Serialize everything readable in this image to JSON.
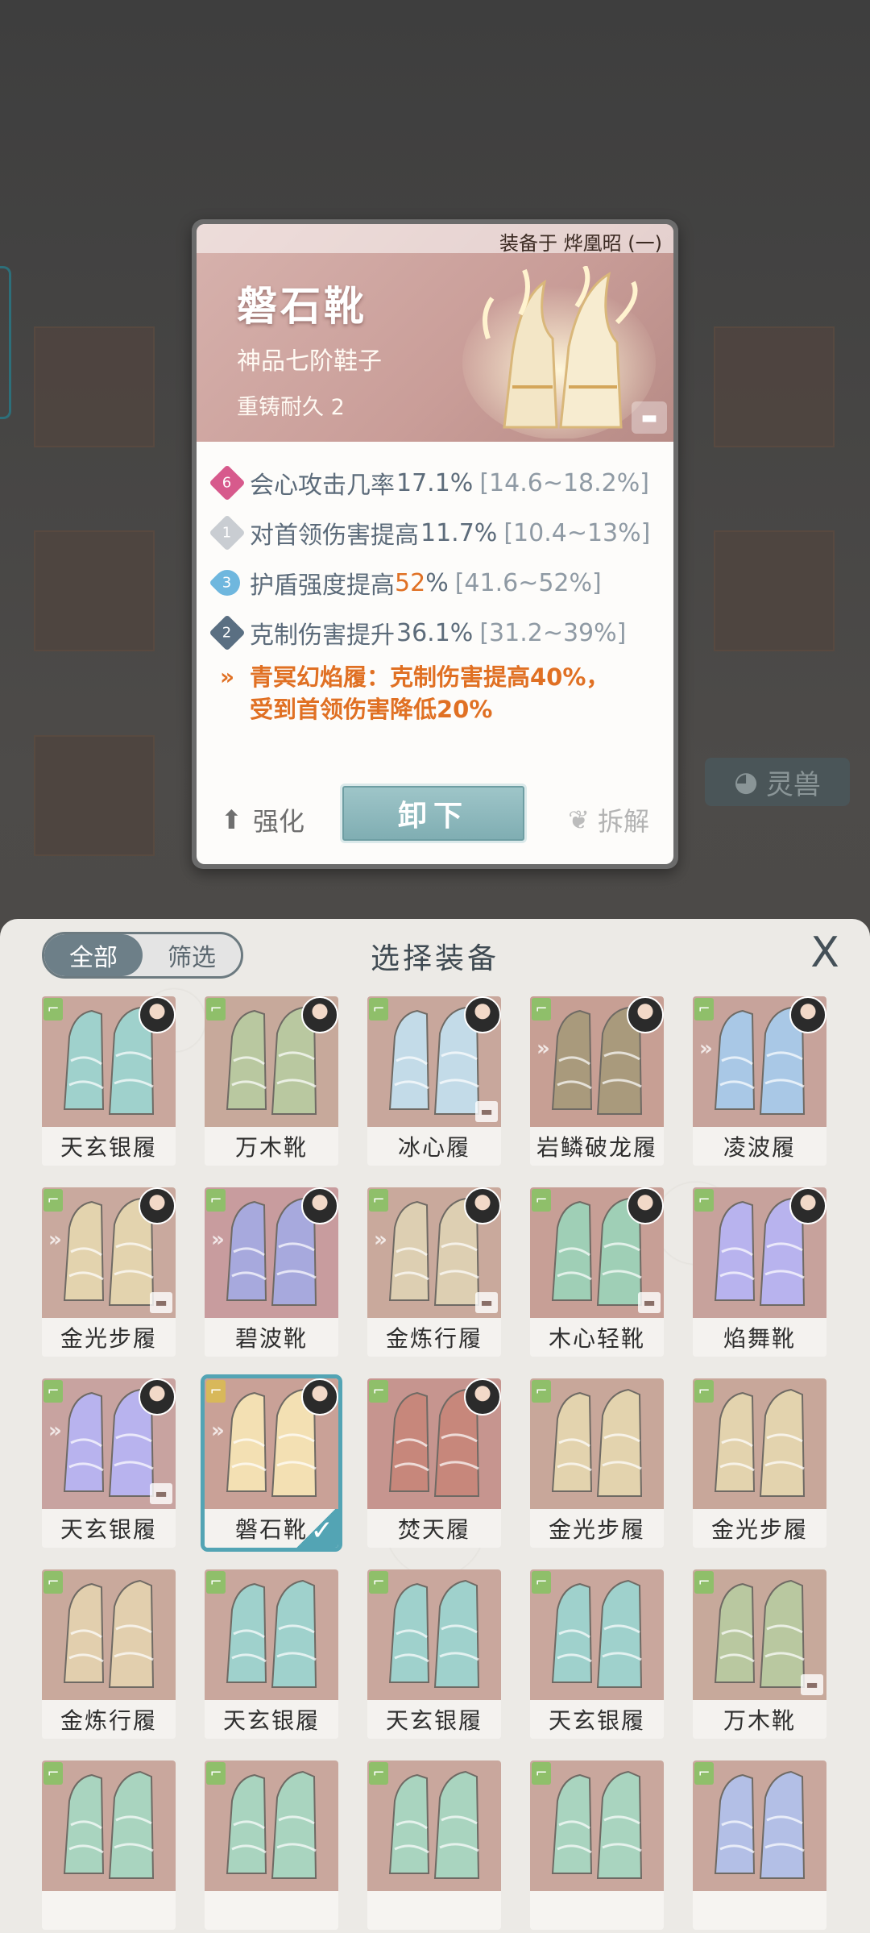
{
  "detail": {
    "equipped_on": "装备于 烨凰昭 (一)",
    "name": "磐石靴",
    "grade": "神品七阶鞋子",
    "durability": "重铸耐久 2",
    "stats": [
      {
        "badge": "6",
        "badge_color": "#d75a8c",
        "name": "会心攻击几率",
        "value": " 17.1%",
        "range": "[14.6~18.2%]"
      },
      {
        "badge": "1",
        "badge_color": "#c9cdd2",
        "name": "对首领伤害提高",
        "value": " 11.7%",
        "range": "[10.4~13%]"
      },
      {
        "badge": "3",
        "badge_color": "#6fb7de",
        "name": "护盾强度提高 ",
        "value_hl": "52",
        "value": "%",
        "range": "[41.6~52%]"
      },
      {
        "badge": "2",
        "badge_color": "#5a6f82",
        "name": "克制伤害提升",
        "value": "36.1%",
        "range": "[31.2~39%]"
      }
    ],
    "set_bonus_line1": "青冥幻焰履：克制伤害提高40%，",
    "set_bonus_line2": "受到首领伤害降低20%",
    "enhance_label": "强化",
    "unequip_label": "卸下",
    "dismantle_label": "拆解"
  },
  "background": {
    "pet_label": "灵兽"
  },
  "panel": {
    "filter_all": "全部",
    "filter_select": "筛选",
    "title": "选择装备",
    "close_glyph": "X"
  },
  "items": [
    {
      "name": "天玄银履",
      "bg": "#c9a79d",
      "boot": "#9fd1cc",
      "avatar": true,
      "set": false,
      "rebuild": false,
      "selected": false
    },
    {
      "name": "万木靴",
      "bg": "#c7a99b",
      "boot": "#b9c8a0",
      "avatar": true,
      "set": false,
      "rebuild": false,
      "selected": false
    },
    {
      "name": "冰心履",
      "bg": "#c8a79c",
      "boot": "#c3dbe8",
      "avatar": true,
      "set": false,
      "rebuild": true,
      "selected": false
    },
    {
      "name": "岩鳞破龙履",
      "bg": "#c79f94",
      "boot": "#a99a7c",
      "avatar": true,
      "set": true,
      "rebuild": false,
      "selected": false
    },
    {
      "name": "凌波履",
      "bg": "#c7a39b",
      "boot": "#a9c8e6",
      "avatar": true,
      "set": true,
      "rebuild": false,
      "selected": false
    },
    {
      "name": "金光步履",
      "bg": "#c9a99e",
      "boot": "#e3d3ae",
      "avatar": true,
      "set": true,
      "rebuild": true,
      "selected": false
    },
    {
      "name": "碧波靴",
      "bg": "#c89c9e",
      "boot": "#a7a9dd",
      "avatar": true,
      "set": true,
      "rebuild": false,
      "selected": false
    },
    {
      "name": "金炼行履",
      "bg": "#c9a99c",
      "boot": "#ddcfb2",
      "avatar": true,
      "set": true,
      "rebuild": true,
      "selected": false
    },
    {
      "name": "木心轻靴",
      "bg": "#c79f96",
      "boot": "#9fcfb6",
      "avatar": true,
      "set": false,
      "rebuild": true,
      "selected": false
    },
    {
      "name": "焰舞靴",
      "bg": "#c7a29c",
      "boot": "#b8b3ee",
      "avatar": true,
      "set": false,
      "rebuild": false,
      "selected": false
    },
    {
      "name": "天玄银履",
      "bg": "#c8a3a0",
      "boot": "#b8b3ee",
      "avatar": true,
      "set": true,
      "rebuild": true,
      "selected": false
    },
    {
      "name": "磐石靴",
      "bg": "#c9a197",
      "boot": "#f3e0b3",
      "avatar": true,
      "set": true,
      "rebuild": false,
      "selected": true
    },
    {
      "name": "焚天履",
      "bg": "#c6958f",
      "boot": "#c7877b",
      "avatar": true,
      "set": false,
      "rebuild": false,
      "selected": false
    },
    {
      "name": "金光步履",
      "bg": "#c8a79a",
      "boot": "#e3d3ae",
      "avatar": false,
      "set": false,
      "rebuild": false,
      "selected": false
    },
    {
      "name": "金光步履",
      "bg": "#c8a79a",
      "boot": "#e3d3ae",
      "avatar": false,
      "set": false,
      "rebuild": false,
      "selected": false
    },
    {
      "name": "金炼行履",
      "bg": "#c9a99c",
      "boot": "#e2cfae",
      "avatar": false,
      "set": false,
      "rebuild": false,
      "selected": false
    },
    {
      "name": "天玄银履",
      "bg": "#c9a79d",
      "boot": "#9fd1cc",
      "avatar": false,
      "set": false,
      "rebuild": false,
      "selected": false
    },
    {
      "name": "天玄银履",
      "bg": "#c9a79d",
      "boot": "#9fd1cc",
      "avatar": false,
      "set": false,
      "rebuild": false,
      "selected": false
    },
    {
      "name": "天玄银履",
      "bg": "#c9a79d",
      "boot": "#9fd1cc",
      "avatar": false,
      "set": false,
      "rebuild": false,
      "selected": false
    },
    {
      "name": "万木靴",
      "bg": "#c7a99b",
      "boot": "#b9c8a0",
      "avatar": false,
      "set": false,
      "rebuild": true,
      "selected": false
    },
    {
      "name": "",
      "bg": "#c9a79d",
      "boot": "#a9d4bf",
      "avatar": false,
      "set": false,
      "rebuild": false,
      "selected": false
    },
    {
      "name": "",
      "bg": "#c9a79d",
      "boot": "#a9d4bf",
      "avatar": false,
      "set": false,
      "rebuild": false,
      "selected": false
    },
    {
      "name": "",
      "bg": "#c9a79d",
      "boot": "#a9d4bf",
      "avatar": false,
      "set": false,
      "rebuild": false,
      "selected": false
    },
    {
      "name": "",
      "bg": "#c9a79d",
      "boot": "#a9d4bf",
      "avatar": false,
      "set": false,
      "rebuild": false,
      "selected": false
    },
    {
      "name": "",
      "bg": "#c9a79d",
      "boot": "#b3bfe6",
      "avatar": false,
      "set": false,
      "rebuild": false,
      "selected": false
    }
  ]
}
